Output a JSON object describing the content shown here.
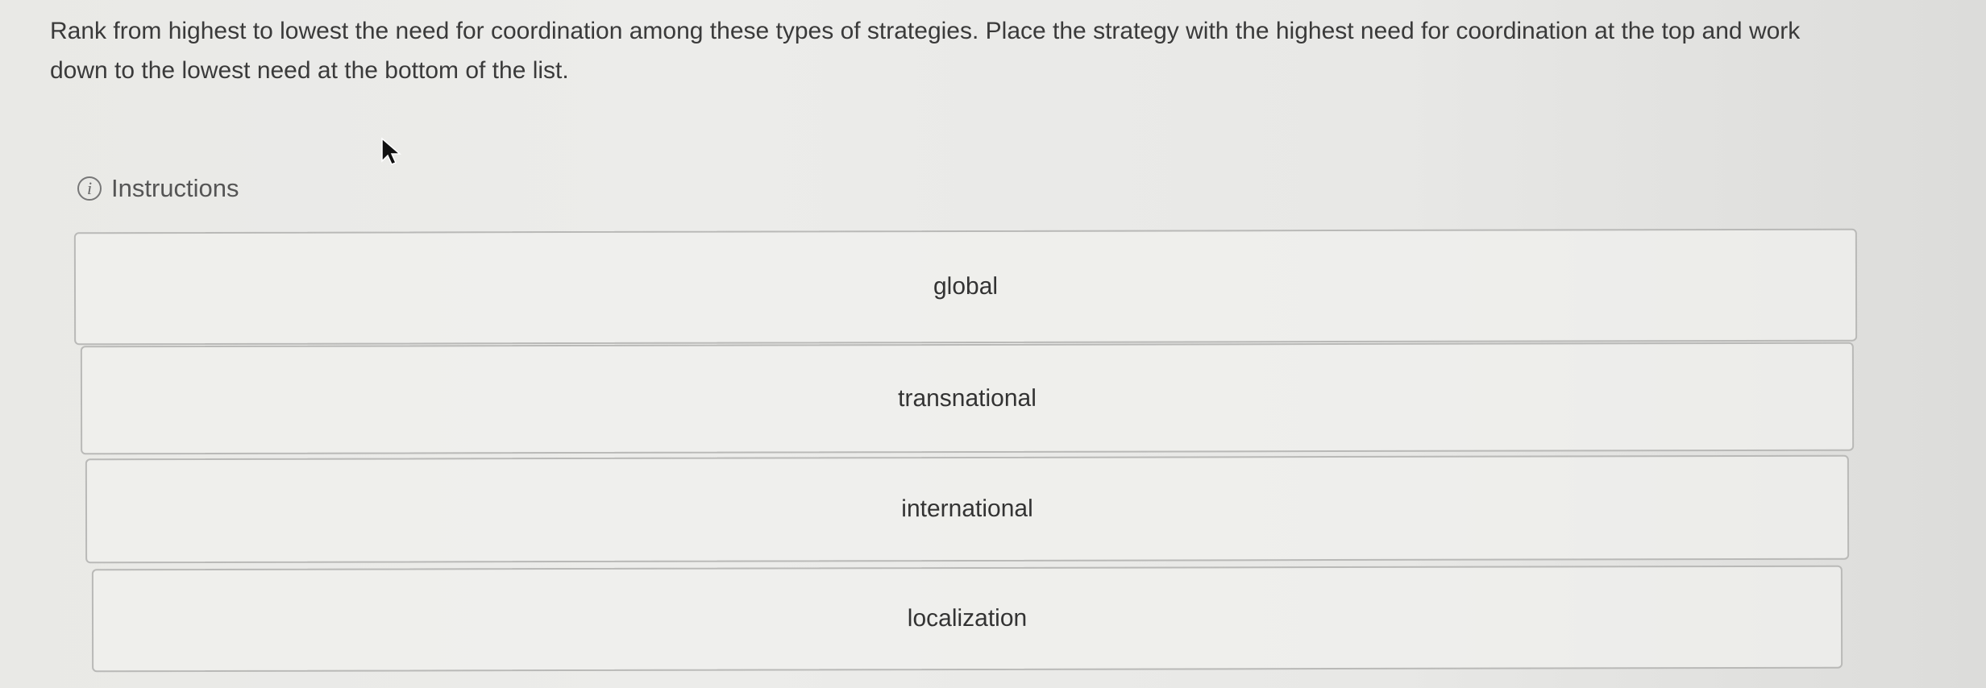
{
  "question": {
    "prompt": "Rank from highest to lowest the need for coordination among these types of strategies. Place the strategy with the highest need for coordination at the top and work down to the lowest need at the bottom of the list."
  },
  "instructions": {
    "icon": "info-icon",
    "icon_glyph": "i",
    "label": "Instructions"
  },
  "rank_list": {
    "items": [
      {
        "label": "global"
      },
      {
        "label": "transnational"
      },
      {
        "label": "international"
      },
      {
        "label": "localization"
      }
    ]
  }
}
